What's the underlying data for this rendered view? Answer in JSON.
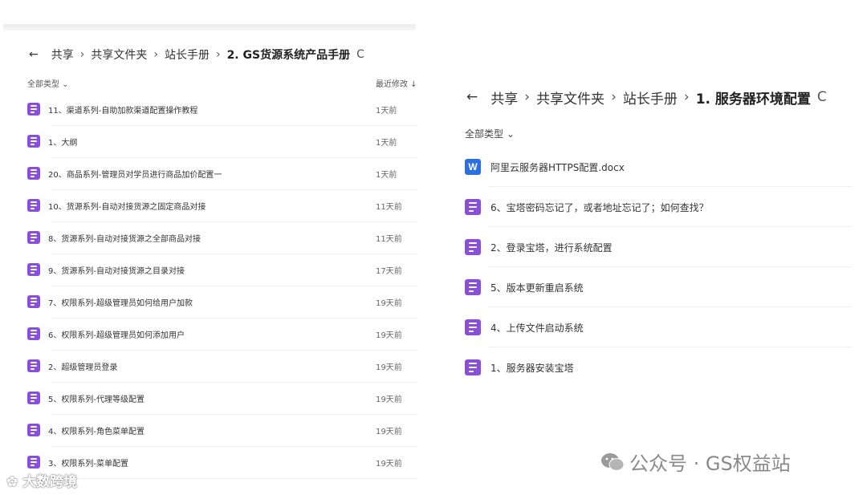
{
  "left_panel": {
    "breadcrumb": {
      "back": "←",
      "items": [
        "共享",
        "共享文件夹",
        "站长手册"
      ],
      "current": "2. GS货源系统产品手册",
      "refresh": "C"
    },
    "filter_label": "全部类型 ⌄",
    "modified_label": "最近修改 ↓",
    "files": [
      {
        "name": "11、渠道系列-自助加款渠道配置操作教程",
        "date": "1天前"
      },
      {
        "name": "1、大纲",
        "date": "1天前"
      },
      {
        "name": "20、商品系列-管理员对学员进行商品加价配置一",
        "date": "1天前"
      },
      {
        "name": "10、货源系列-自动对接货源之固定商品对接",
        "date": "11天前"
      },
      {
        "name": "8、货源系列-自动对接货源之全部商品对接",
        "date": "11天前"
      },
      {
        "name": "9、货源系列-自动对接货源之目录对接",
        "date": "17天前"
      },
      {
        "name": "7、权限系列-超级管理员如何给用户加款",
        "date": "19天前"
      },
      {
        "name": "6、权限系列-超级管理员如何添加用户",
        "date": "19天前"
      },
      {
        "name": "2、超级管理员登录",
        "date": "19天前"
      },
      {
        "name": "5、权限系列-代理等级配置",
        "date": "19天前"
      },
      {
        "name": "4、权限系列-角色菜单配置",
        "date": "19天前"
      },
      {
        "name": "3、权限系列-菜单配置",
        "date": "19天前"
      }
    ]
  },
  "right_panel": {
    "breadcrumb": {
      "back": "←",
      "items": [
        "共享",
        "共享文件夹",
        "站长手册"
      ],
      "current": "1. 服务器环境配置",
      "refresh": "C"
    },
    "filter_label": "全部类型 ⌄",
    "files": [
      {
        "name": "阿里云服务器HTTPS配置.docx",
        "type": "word",
        "icon_letter": "W"
      },
      {
        "name": "6、宝塔密码忘记了，或者地址忘记了；如何查找？",
        "type": "note"
      },
      {
        "name": "2、登录宝塔，进行系统配置",
        "type": "note"
      },
      {
        "name": "5、版本更新重启系统",
        "type": "note"
      },
      {
        "name": "4、上传文件启动系统",
        "type": "note"
      },
      {
        "name": "1、服务器安装宝塔",
        "type": "note"
      }
    ]
  },
  "watermarks": {
    "left": "大数跨境",
    "right": "公众号 · GS权益站"
  },
  "colors": {
    "note_icon": "#8a4fd8",
    "word_icon": "#2b6fe0"
  }
}
